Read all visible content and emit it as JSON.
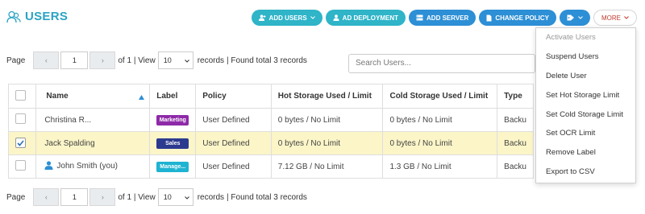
{
  "header": {
    "title": "USERS"
  },
  "toolbar": {
    "add_users": "ADD USERS",
    "ad_deployment": "AD DEPLOYMENT",
    "add_server": "ADD SERVER",
    "change_policy": "CHANGE POLICY",
    "more": "MORE"
  },
  "pager": {
    "page_label": "Page",
    "prev": "‹",
    "page_value": "1",
    "next": "›",
    "of_text": "of 1 | View",
    "view_value": "10",
    "records_text": "records",
    "found_text": "| Found total 3 records"
  },
  "search": {
    "placeholder": "Search Users..."
  },
  "table": {
    "headers": [
      "Name",
      "Label",
      "Policy",
      "Hot Storage Used / Limit",
      "Cold Storage Used / Limit",
      "Type"
    ],
    "rows": [
      {
        "name": "Christina R...",
        "label": "Marketing",
        "label_color": "#8e2aa8",
        "policy": "User Defined",
        "hot": "0 bytes / No Limit",
        "cold": "0 bytes / No Limit",
        "type": "Backu",
        "checked": false
      },
      {
        "name": "Jack Spalding",
        "label": "Sales",
        "label_color": "#2b3a8f",
        "policy": "User Defined",
        "hot": "0 bytes / No Limit",
        "cold": "0 bytes / No Limit",
        "type": "Backu",
        "checked": true
      },
      {
        "name": "John Smith (you)",
        "label": "Manage...",
        "label_color": "#1fb3d2",
        "policy": "User Defined",
        "hot": "7.12 GB / No Limit",
        "cold": "1.3 GB / No Limit",
        "type": "Backu",
        "checked": false
      }
    ]
  },
  "menu": {
    "items": [
      "Activate Users",
      "Suspend Users",
      "Delete User",
      "Set Hot Storage Limit",
      "Set Cold Storage Limit",
      "Set OCR Limit",
      "Remove Label",
      "Export to CSV"
    ]
  },
  "colors": {
    "accent": "#2aa3c4",
    "teal": "#2fb4c8",
    "blue": "#2d8fd5",
    "more_text": "#c0392b",
    "selected_row": "#fbf5c8"
  }
}
